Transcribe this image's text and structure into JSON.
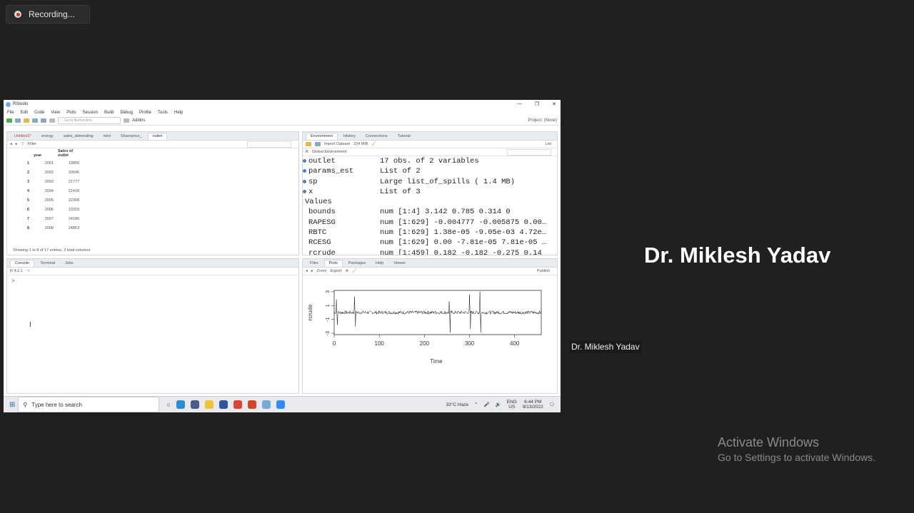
{
  "recording": {
    "label": "Recording..."
  },
  "presenter": {
    "name": "Dr. Miklesh Yadav",
    "tag": "Dr. Miklesh Yadav"
  },
  "watermark": {
    "line1": "Activate Windows",
    "line2": "Go to Settings to activate Windows."
  },
  "rstudio": {
    "title": "RStudio",
    "menu": [
      "File",
      "Edit",
      "Code",
      "View",
      "Plots",
      "Session",
      "Build",
      "Debug",
      "Profile",
      "Tools",
      "Help"
    ],
    "goto_placeholder": "Go to file/function",
    "addins": "Addins",
    "project": "Project: (None)",
    "source": {
      "tabs": [
        "Untitled1*",
        "energy",
        "sales_detrending",
        "mint",
        "Shareprice_",
        "outlet"
      ],
      "filter": "Filter",
      "columns": [
        "year",
        "Sales of outlet"
      ],
      "rows": [
        {
          "n": "1",
          "year": "2001",
          "sales": "19856"
        },
        {
          "n": "2",
          "year": "2002",
          "sales": "20546"
        },
        {
          "n": "3",
          "year": "2003",
          "sales": "21777"
        },
        {
          "n": "4",
          "year": "2004",
          "sales": "22418"
        },
        {
          "n": "5",
          "year": "2005",
          "sales": "22308"
        },
        {
          "n": "6",
          "year": "2006",
          "sales": "23319"
        },
        {
          "n": "7",
          "year": "2007",
          "sales": "24180"
        },
        {
          "n": "8",
          "year": "2008",
          "sales": "24853"
        }
      ],
      "footer": "Showing 1 to 8 of 17 entries, 2 total columns"
    },
    "environment": {
      "tabs": [
        "Environment",
        "History",
        "Connections",
        "Tutorial"
      ],
      "import": "Import Dataset",
      "memory": "234 MiB",
      "view": "List",
      "lang": "R",
      "scope": "Global Environment",
      "data_rows": [
        {
          "name": "outlet",
          "value": "17 obs. of 2 variables"
        },
        {
          "name": "params_est",
          "value": "List of  2"
        },
        {
          "name": "sp",
          "value": "Large list_of_spills ( 1.4 MB)"
        },
        {
          "name": "x",
          "value": "List of  3"
        }
      ],
      "values_header": "Values",
      "value_rows": [
        {
          "name": "bounds",
          "value": "num [1:4] 3.142 0.785 0.314 0"
        },
        {
          "name": "RAPESG",
          "value": "num [1:629] -0.004777 -0.005875 0.00…"
        },
        {
          "name": "RBTC",
          "value": "num [1:629] 1.38e-05 -9.05e-03 4.72e…"
        },
        {
          "name": "RCESG",
          "value": "num [1:629] 0.00 -7.81e-05 7.81e-05 …"
        },
        {
          "name": "rcrude",
          "value": "num [1:459] 0.182 -0.182 -0.275 0.14"
        }
      ]
    },
    "console": {
      "tabs": [
        "Console",
        "Terminal",
        "Jobs"
      ],
      "version": "R 4.2.1 · ~/",
      "prompt": ">"
    },
    "files": {
      "tabs": [
        "Files",
        "Plots",
        "Packages",
        "Help",
        "Viewer"
      ],
      "zoom": "Zoom",
      "export": "Export",
      "publish": "Publish"
    }
  },
  "chart_data": {
    "type": "line",
    "xlabel": "Time",
    "ylabel": "rcrude",
    "x_ticks": [
      "0",
      "100",
      "200",
      "300",
      "400"
    ],
    "y_ticks": [
      "-3",
      "-1",
      "1",
      "3"
    ],
    "xlim": [
      0,
      459
    ],
    "ylim": [
      -3.2,
      3.2
    ],
    "spikes": [
      {
        "x": 5,
        "y": 1.9
      },
      {
        "x": 7,
        "y": -1.8
      },
      {
        "x": 45,
        "y": 2.3
      },
      {
        "x": 47,
        "y": -2.0
      },
      {
        "x": 255,
        "y": 1.6
      },
      {
        "x": 257,
        "y": -2.9
      },
      {
        "x": 300,
        "y": 2.6
      },
      {
        "x": 302,
        "y": -2.4
      },
      {
        "x": 323,
        "y": 3.0
      },
      {
        "x": 325,
        "y": -2.9
      }
    ]
  },
  "taskbar": {
    "search": "Type here to search",
    "weather": "33°C  Haze",
    "lang": "ENG",
    "region": "US",
    "time": "6:44 PM",
    "date": "9/13/2022"
  }
}
